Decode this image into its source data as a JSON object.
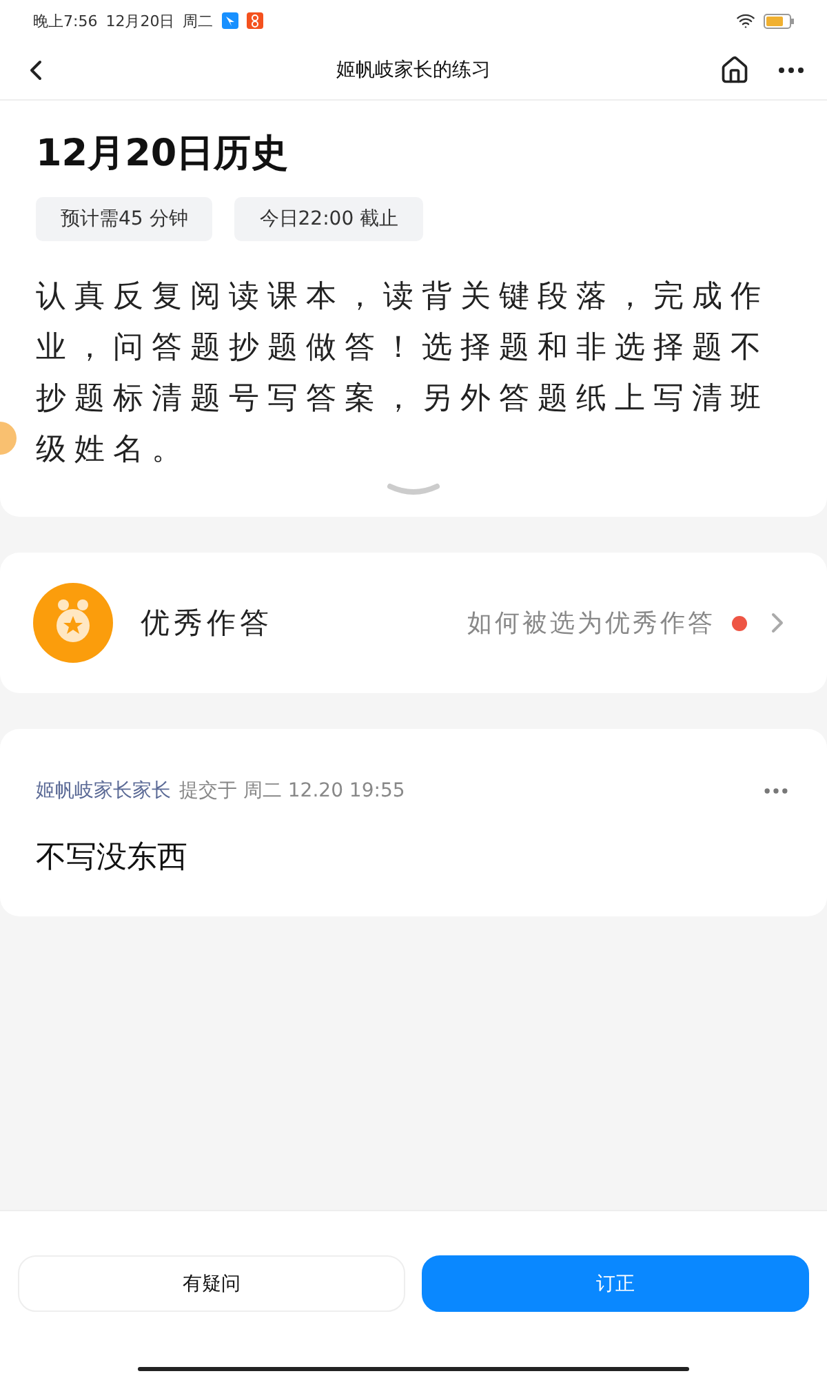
{
  "status_bar": {
    "time": "晚上7:56",
    "date": "12月20日",
    "weekday": "周二"
  },
  "nav": {
    "title": "姬帆岐家长的练习"
  },
  "assignment": {
    "title": "12月20日历史",
    "tags": [
      "预计需45 分钟",
      "今日22:00 截止"
    ],
    "description": "认真反复阅读课本，读背关键段落，完成作业，问答题抄题做答！选择题和非选择题不抄题标清题号写答案，另外答题纸上写清班级姓名。"
  },
  "excellent": {
    "label": "优秀作答",
    "link": "如何被选为优秀作答",
    "unread": true
  },
  "submission": {
    "author": "姬帆岐家长家长",
    "meta": "提交于 周二 12.20 19:55",
    "content": "不写没东西"
  },
  "buttons": [
    {
      "label": "有疑问",
      "kind": "secondary"
    },
    {
      "label": "订正",
      "kind": "primary"
    }
  ]
}
